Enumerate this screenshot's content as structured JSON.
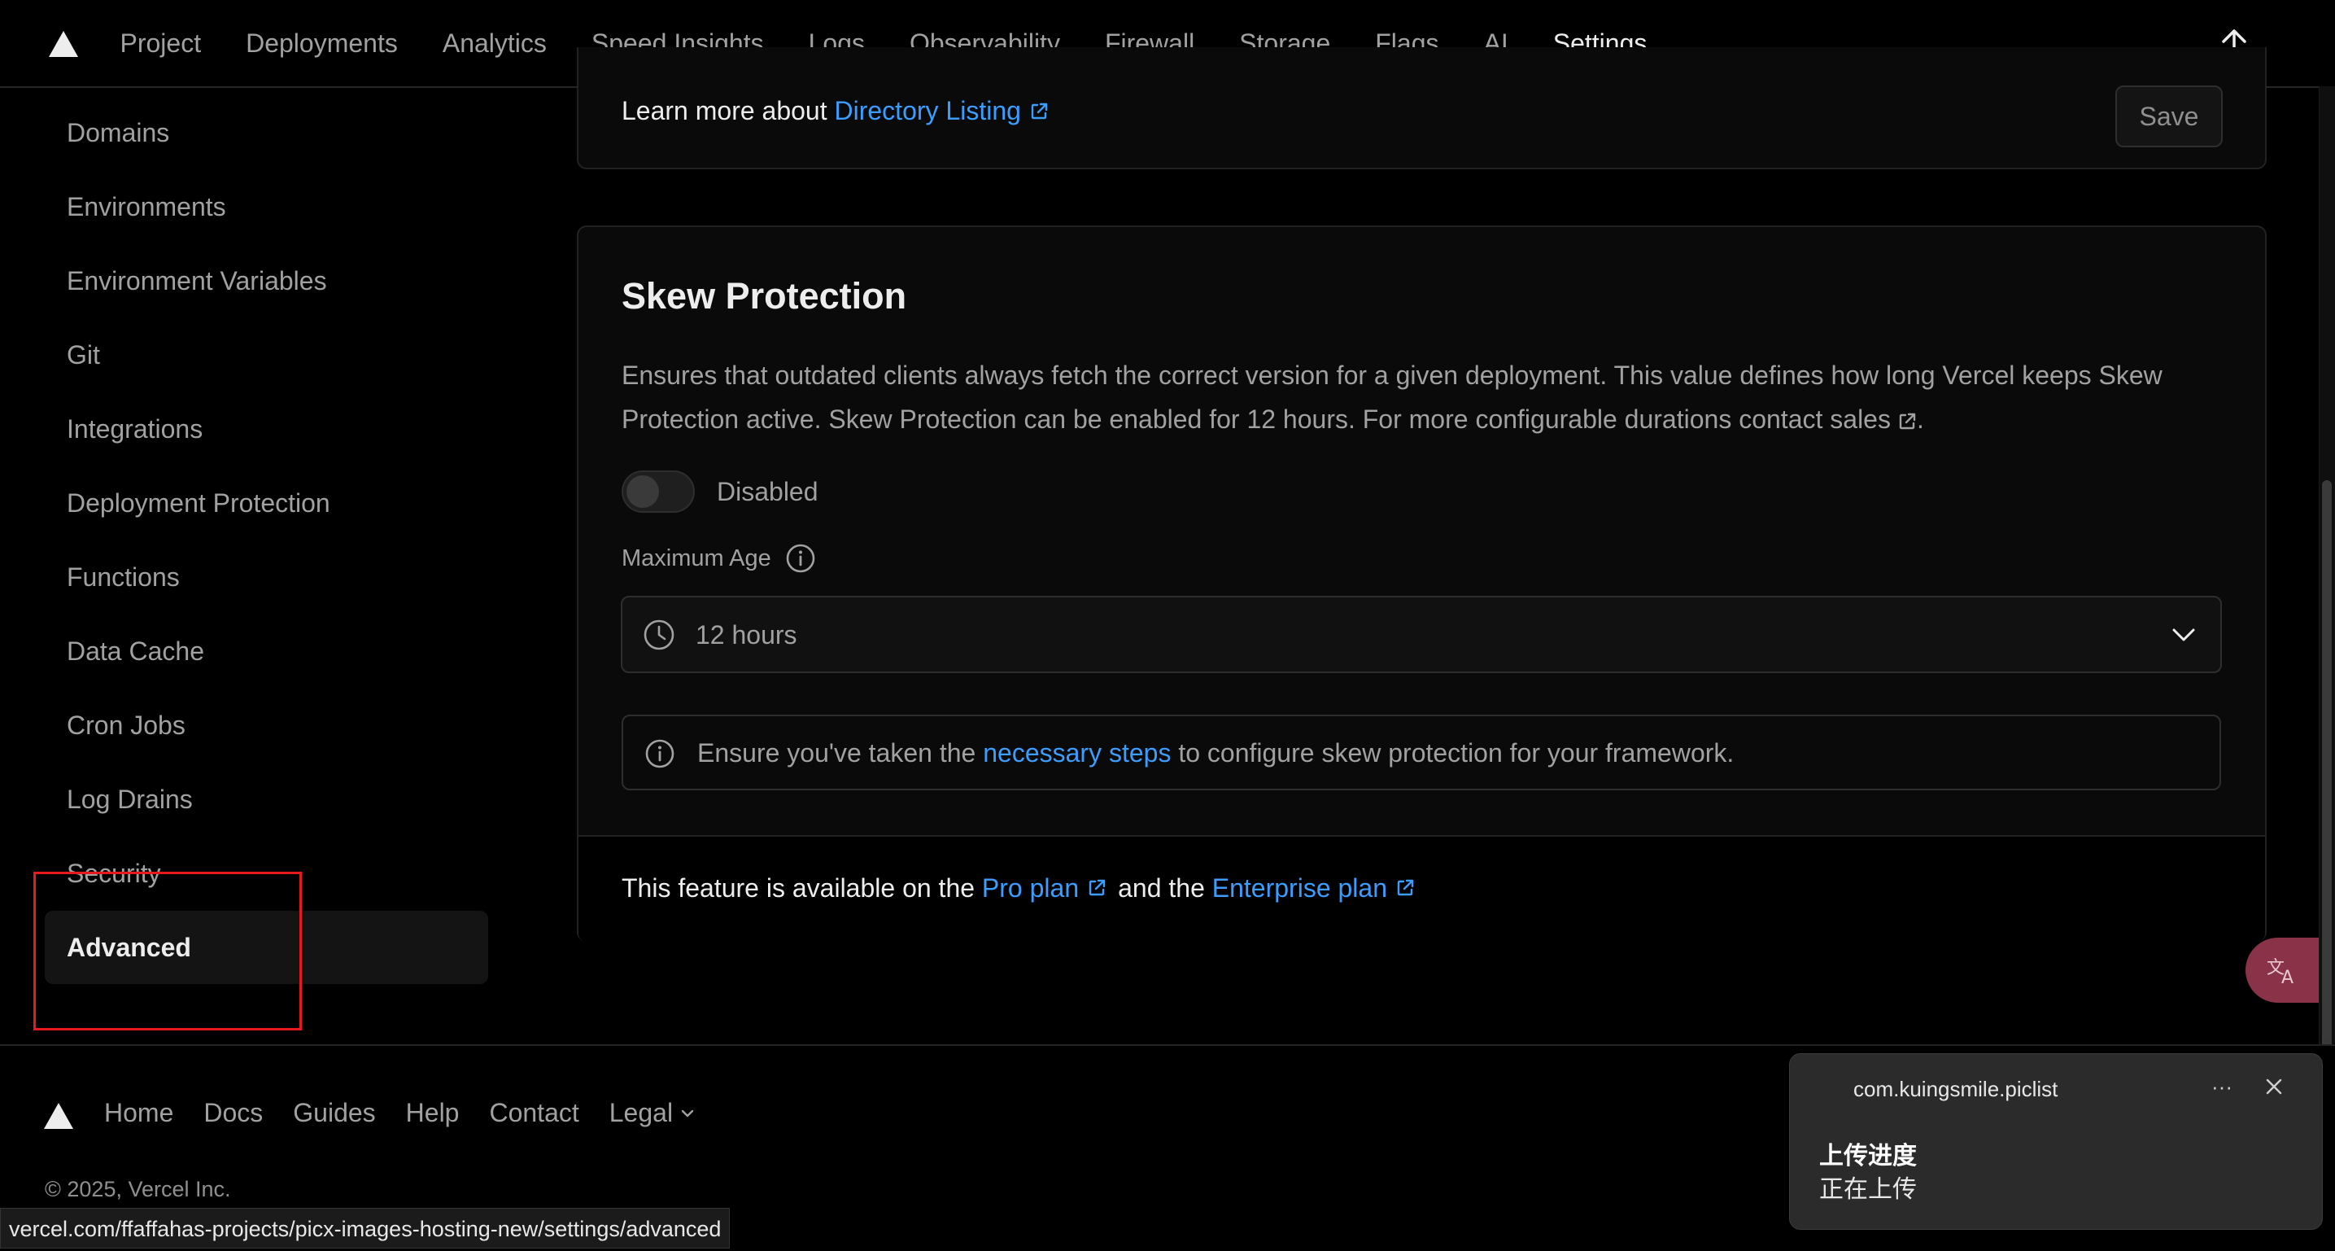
{
  "nav": {
    "tabs": [
      {
        "label": "Project"
      },
      {
        "label": "Deployments"
      },
      {
        "label": "Analytics"
      },
      {
        "label": "Speed Insights"
      },
      {
        "label": "Logs"
      },
      {
        "label": "Observability"
      },
      {
        "label": "Firewall"
      },
      {
        "label": "Storage"
      },
      {
        "label": "Flags"
      },
      {
        "label": "AI"
      },
      {
        "label": "Settings"
      }
    ],
    "active_tab": "Settings"
  },
  "sidebar": {
    "items": [
      {
        "label": "Domains"
      },
      {
        "label": "Environments"
      },
      {
        "label": "Environment Variables"
      },
      {
        "label": "Git"
      },
      {
        "label": "Integrations"
      },
      {
        "label": "Deployment Protection"
      },
      {
        "label": "Functions"
      },
      {
        "label": "Data Cache"
      },
      {
        "label": "Cron Jobs"
      },
      {
        "label": "Log Drains"
      },
      {
        "label": "Security"
      },
      {
        "label": "Advanced"
      }
    ],
    "active_item": "Advanced"
  },
  "directory_listing": {
    "learn_prefix": "Learn more about",
    "link_label": "Directory Listing",
    "save_label": "Save"
  },
  "skew": {
    "title": "Skew Protection",
    "description": "Ensures that outdated clients always fetch the correct version for a given deployment. This value defines how long Vercel keeps Skew Protection active. Skew Protection can be enabled for 12 hours. For more configurable durations contact sales",
    "description_end": ".",
    "toggle_label": "Disabled",
    "toggle_on": false,
    "max_age_label": "Maximum Age",
    "max_age_value": "12 hours",
    "note_prefix": "Ensure you've taken the",
    "note_link": "necessary steps",
    "note_suffix": "to configure skew protection for your framework.",
    "availability_prefix": "This feature is available on the",
    "pro_plan": "Pro plan",
    "and_the": "and the",
    "enterprise_plan": "Enterprise plan"
  },
  "footer": {
    "links": [
      {
        "label": "Home"
      },
      {
        "label": "Docs"
      },
      {
        "label": "Guides"
      },
      {
        "label": "Help"
      },
      {
        "label": "Contact"
      }
    ],
    "legal_label": "Legal",
    "copyright": "© 2025, Vercel Inc."
  },
  "status_url": "vercel.com/ffaffahas-projects/picx-images-hosting-new/settings/advanced",
  "toast": {
    "app": "com.kuingsmile.piclist",
    "more": "···",
    "title": "上传进度",
    "body": "正在上传"
  },
  "colors": {
    "accent_link": "#3b9eff",
    "highlight_box": "#e5191e",
    "background": "#000000"
  },
  "icons": [
    "vercel-logo-icon",
    "arrow-up-icon",
    "external-link-icon",
    "info-icon",
    "clock-icon",
    "chevron-down-icon",
    "translate-icon",
    "close-icon"
  ]
}
